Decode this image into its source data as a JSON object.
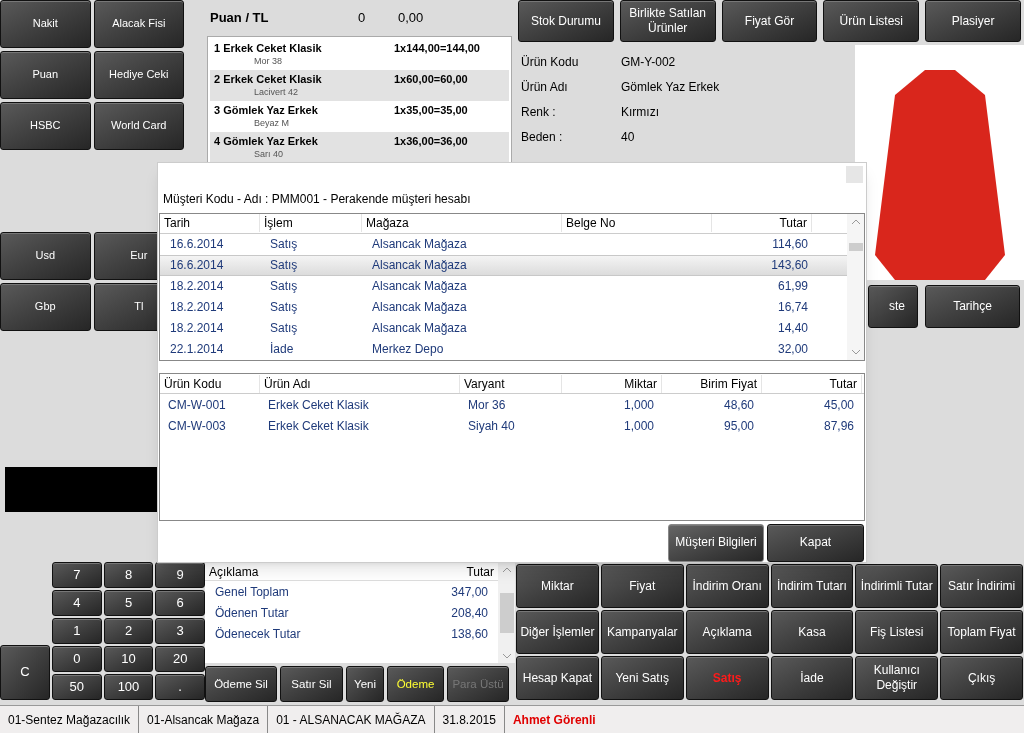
{
  "payment_buttons": [
    "Nakit",
    "Alacak Fisi",
    "Puan",
    "Hediye Ceki",
    "HSBC",
    "World Card"
  ],
  "currency_buttons": [
    "Usd",
    "Eur",
    "Gbp",
    "Tl"
  ],
  "numpad": {
    "clear": "C",
    "keys": [
      "7",
      "8",
      "9",
      "4",
      "5",
      "6",
      "1",
      "2",
      "3",
      "0",
      "10",
      "20",
      "50",
      "100",
      "."
    ]
  },
  "points": {
    "label": "Puan / TL",
    "count": "0",
    "amount": "0,00"
  },
  "sale_lines": [
    {
      "name": "1 Erkek Ceket Klasik",
      "variant": "Mor 38",
      "price": "1x144,00=144,00"
    },
    {
      "name": "2 Erkek Ceket Klasik",
      "variant": "Lacivert 42",
      "price": "1x60,00=60,00"
    },
    {
      "name": "3 Gömlek Yaz Erkek",
      "variant": "Beyaz M",
      "price": "1x35,00=35,00"
    },
    {
      "name": "4 Gömlek Yaz Erkek",
      "variant": "Sarı 40",
      "price": "1x36,00=36,00"
    }
  ],
  "top_buttons": [
    "Stok Durumu",
    "Birlikte Satılan Ürünler",
    "Fiyat Gör",
    "Ürün Listesi",
    "Plasiyer"
  ],
  "product_info": [
    {
      "label": "Ürün Kodu",
      "value": "GM-Y-002"
    },
    {
      "label": "Ürün Adı",
      "value": "Gömlek Yaz Erkek"
    },
    {
      "label": "Renk :",
      "value": "Kırmızı"
    },
    {
      "label": "Beden :",
      "value": "40"
    }
  ],
  "side_buttons": [
    "ste",
    "Tarihçe"
  ],
  "summary": {
    "columns": [
      "Açıklama",
      "Tutar"
    ],
    "rows": [
      {
        "label": "Genel Toplam",
        "value": "347,00"
      },
      {
        "label": "Ödenen Tutar",
        "value": "208,40"
      },
      {
        "label": "Ödenecek Tutar",
        "value": "138,60"
      }
    ]
  },
  "payment_actions": [
    {
      "label": "Ödeme Sil",
      "kind": "normal"
    },
    {
      "label": "Satır Sil",
      "kind": "normal"
    },
    {
      "label": "Yeni",
      "kind": "normal"
    },
    {
      "label": "Ödeme",
      "kind": "highlight"
    },
    {
      "label": "Para Üstü",
      "kind": "disabled"
    }
  ],
  "function_buttons": [
    {
      "label": "Miktar",
      "kind": "normal"
    },
    {
      "label": "Fiyat",
      "kind": "normal"
    },
    {
      "label": "İndirim Oranı",
      "kind": "normal"
    },
    {
      "label": "İndirim Tutarı",
      "kind": "normal"
    },
    {
      "label": "İndirimli Tutar",
      "kind": "normal"
    },
    {
      "label": "Satır İndirimi",
      "kind": "normal"
    },
    {
      "label": "Diğer İşlemler",
      "kind": "normal"
    },
    {
      "label": "Kampanyalar",
      "kind": "normal"
    },
    {
      "label": "Açıklama",
      "kind": "normal"
    },
    {
      "label": "Kasa",
      "kind": "normal"
    },
    {
      "label": "Fiş Listesi",
      "kind": "normal"
    },
    {
      "label": "Toplam Fiyat",
      "kind": "normal"
    },
    {
      "label": "Hesap Kapat",
      "kind": "normal"
    },
    {
      "label": "Yeni Satış",
      "kind": "normal"
    },
    {
      "label": "Satış",
      "kind": "active"
    },
    {
      "label": "İade",
      "kind": "normal"
    },
    {
      "label": "Kullanıcı Değiştir",
      "kind": "normal"
    },
    {
      "label": "Çıkış",
      "kind": "normal"
    }
  ],
  "status_bar": {
    "segments": [
      "01-Sentez Mağazacılık",
      "01-Alsancak Mağaza",
      "01 - ALSANACAK MAĞAZA",
      "31.8.2015"
    ],
    "user": "Ahmet Görenli"
  },
  "dialog": {
    "title": "Müşteri Kodu - Adı : PMM001 - Perakende müşteri hesabı",
    "receipts": {
      "columns": [
        "Tarih",
        "İşlem",
        "Mağaza",
        "Belge No",
        "Tutar"
      ],
      "rows": [
        {
          "cells": [
            "16.6.2014",
            "Satış",
            "Alsancak Mağaza",
            "",
            "114,60"
          ],
          "selected": false
        },
        {
          "cells": [
            "16.6.2014",
            "Satış",
            "Alsancak Mağaza",
            "",
            "143,60"
          ],
          "selected": true
        },
        {
          "cells": [
            "18.2.2014",
            "Satış",
            "Alsancak Mağaza",
            "",
            "61,99"
          ],
          "selected": false
        },
        {
          "cells": [
            "18.2.2014",
            "Satış",
            "Alsancak Mağaza",
            "",
            "16,74"
          ],
          "selected": false
        },
        {
          "cells": [
            "18.2.2014",
            "Satış",
            "Alsancak Mağaza",
            "",
            "14,40"
          ],
          "selected": false
        },
        {
          "cells": [
            "22.1.2014",
            "İade",
            "Merkez Depo",
            "",
            "32,00"
          ],
          "selected": false
        }
      ]
    },
    "lines": {
      "columns": [
        "Ürün Kodu",
        "Ürün Adı",
        "Varyant",
        "Miktar",
        "Birim Fiyat",
        "Tutar"
      ],
      "rows": [
        [
          "CM-W-001",
          "Erkek Ceket Klasik",
          "Mor 36",
          "1,000",
          "48,60",
          "45,00"
        ],
        [
          "CM-W-003",
          "Erkek Ceket Klasik",
          "Siyah 40",
          "1,000",
          "95,00",
          "87,96"
        ]
      ]
    },
    "buttons": [
      "Müşteri Bilgileri",
      "Kapat"
    ]
  }
}
